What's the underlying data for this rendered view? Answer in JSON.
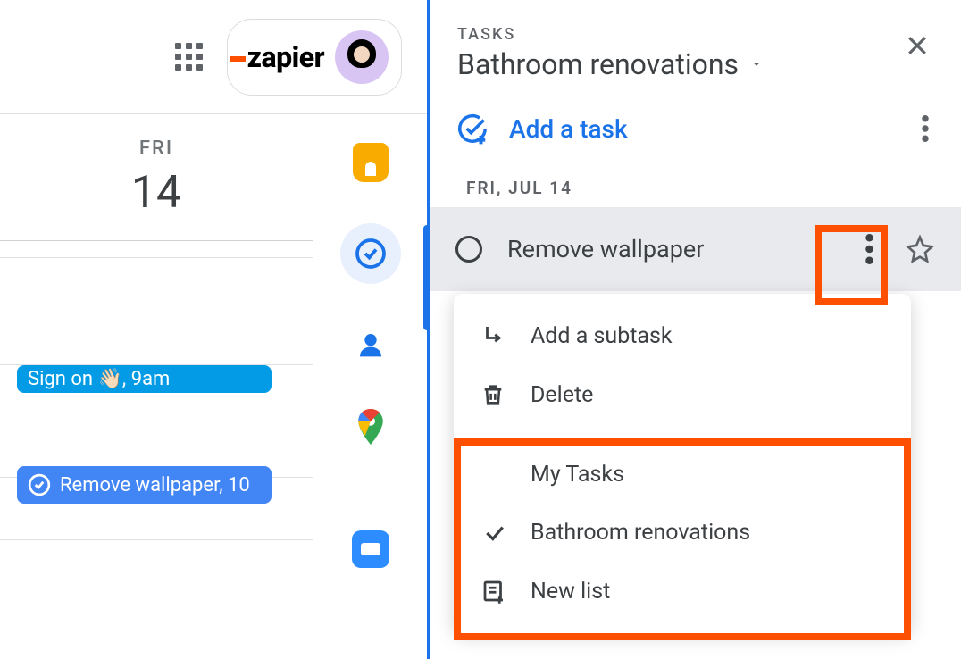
{
  "topbar": {
    "brand": "zapier"
  },
  "calendar": {
    "day_name": "FRI",
    "day_num": "14",
    "events": [
      {
        "title": "Sign on 👋🏻, 9am"
      },
      {
        "title": "Remove wallpaper, 10"
      }
    ]
  },
  "tasks": {
    "section_label": "TASKS",
    "list_title": "Bathroom renovations",
    "add_label": "Add a task",
    "date_header": "FRI, JUL 14",
    "task_title": "Remove wallpaper"
  },
  "menu": {
    "add_subtask": "Add a subtask",
    "delete": "Delete",
    "my_tasks": "My Tasks",
    "bathroom": "Bathroom renovations",
    "new_list": "New list"
  }
}
